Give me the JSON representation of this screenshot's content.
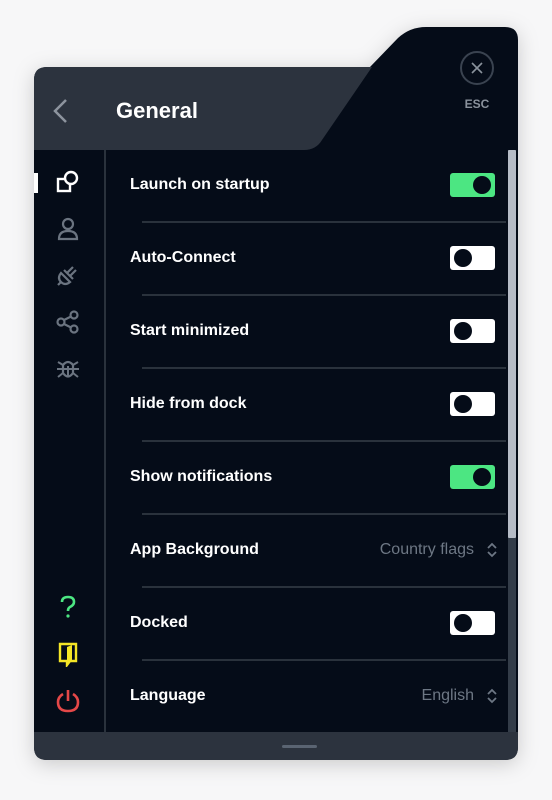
{
  "header": {
    "title": "General",
    "back_icon": "chevron-left-icon",
    "close_icon": "close-icon",
    "esc_label": "ESC"
  },
  "sidebar": {
    "items": [
      {
        "name": "general",
        "icon": "shapes-icon",
        "active": true
      },
      {
        "name": "account",
        "icon": "user-icon",
        "active": false
      },
      {
        "name": "connection",
        "icon": "plug-icon",
        "active": false
      },
      {
        "name": "split-tunneling",
        "icon": "share-icon",
        "active": false
      },
      {
        "name": "debug",
        "icon": "bug-icon",
        "active": false
      }
    ],
    "bottom_items": [
      {
        "name": "help",
        "icon": "question-icon",
        "color": "#4ce682"
      },
      {
        "name": "guides",
        "icon": "door-icon",
        "color": "#f5e626"
      },
      {
        "name": "quit",
        "icon": "power-icon",
        "color": "#e54848"
      }
    ]
  },
  "settings": [
    {
      "label": "Launch on startup",
      "type": "toggle",
      "value": true
    },
    {
      "label": "Auto-Connect",
      "type": "toggle",
      "value": false
    },
    {
      "label": "Start minimized",
      "type": "toggle",
      "value": false
    },
    {
      "label": "Hide from dock",
      "type": "toggle",
      "value": false
    },
    {
      "label": "Show notifications",
      "type": "toggle",
      "value": true
    },
    {
      "label": "App Background",
      "type": "select",
      "value": "Country flags"
    },
    {
      "label": "Docked",
      "type": "toggle",
      "value": false
    },
    {
      "label": "Language",
      "type": "select",
      "value": "English"
    }
  ],
  "colors": {
    "accent_on": "#4ce682",
    "panel_dark": "#050c18",
    "header_bg": "#2c333e"
  },
  "scroll": {
    "visible_fraction": 0.67,
    "position": 0
  }
}
